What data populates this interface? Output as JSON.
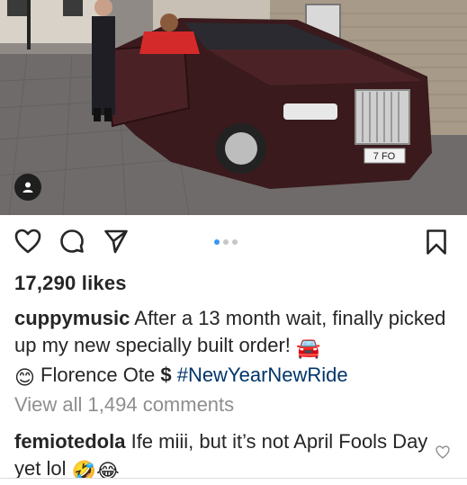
{
  "post": {
    "image_alt_icons": {
      "tag": "user-tag-icon"
    },
    "carousel": {
      "count": 3,
      "active_index": 0
    },
    "likes_text": "17,290 likes",
    "caption": {
      "username": "cuppymusic",
      "text_part1": " After a 13 month wait, finally picked up my new specially built order! ",
      "car_emoji": "🚘",
      "smile_emoji": "😊",
      "text_part2": " Florence Ote ",
      "dollar": "$",
      "hashtag": "#NewYearNewRide"
    },
    "view_all_comments": "View all 1,494 comments",
    "top_comment": {
      "username": "femiotedola",
      "text": " Ife miii, but it’s not April Fools Day yet lol ",
      "emojis": "🤣😂"
    },
    "plate_text": "7 FO"
  },
  "colors": {
    "hashtag": "#003569",
    "muted": "#8e8e8e",
    "carousel_active": "#3897f0"
  }
}
